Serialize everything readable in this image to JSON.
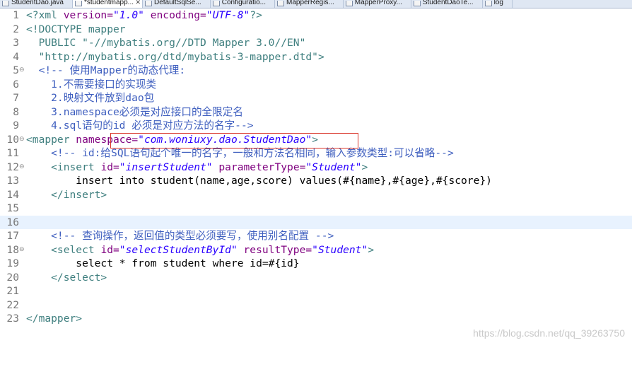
{
  "tabs": [
    {
      "label": "StudentDao.java",
      "active": false,
      "icon": "java-file-icon"
    },
    {
      "label": "*studentmapp...",
      "active": true,
      "icon": "xml-file-icon"
    },
    {
      "label": "DefaultSqlSe...",
      "active": false,
      "icon": "class-file-icon"
    },
    {
      "label": "Configuratio...",
      "active": false,
      "icon": "class-file-icon"
    },
    {
      "label": "MapperRegis...",
      "active": false,
      "icon": "class-file-icon"
    },
    {
      "label": "MapperProxy...",
      "active": false,
      "icon": "class-file-icon"
    },
    {
      "label": "StudentDaoTe...",
      "active": false,
      "icon": "java-file-icon"
    },
    {
      "label": "log",
      "active": false,
      "icon": "file-icon"
    }
  ],
  "tab_close": "✕",
  "code": {
    "l1": {
      "num": "1",
      "a": "<?xml ",
      "b": "version=",
      "c": "\"1.0\"",
      "d": " encoding=",
      "e": "\"UTF-8\"",
      "f": "?>"
    },
    "l2": {
      "num": "2",
      "a": "<!DOCTYPE mapper"
    },
    "l3": {
      "num": "3",
      "a": "  PUBLIC \"-//mybatis.org//DTD Mapper 3.0//EN\""
    },
    "l4": {
      "num": "4",
      "a": "  \"http://mybatis.org/dtd/mybatis-3-mapper.dtd\">"
    },
    "l5": {
      "num": "5",
      "a": "  <!-- 使用Mapper的动态代理:"
    },
    "l6": {
      "num": "6",
      "a": "    1.不需要接口的实现类"
    },
    "l7": {
      "num": "7",
      "a": "    2.映射文件放到dao包"
    },
    "l8": {
      "num": "8",
      "a": "    3.namespace必须是对应接口的全限定名"
    },
    "l9": {
      "num": "9",
      "a": "    4.sql语句的id 必须是对应方法的名字-->"
    },
    "l10": {
      "num": "10",
      "a": "<mapper ",
      "b": "namespace=",
      "c": "\"com.woniuxy.dao.StudentDao\"",
      "d": ">"
    },
    "l11": {
      "num": "11",
      "a": "    <!-- id:给SQL语句起个唯一的名字，一般和方法名相同，输入参数类型:可以省略-->"
    },
    "l12": {
      "num": "12",
      "a": "    <insert ",
      "b": "id=",
      "c": "\"insertStudent\"",
      "d": " parameterType=",
      "e": "\"Student\"",
      "f": ">"
    },
    "l13": {
      "num": "13",
      "a": "        insert into student(name,age,score) values(#{name},#{age},#{score})"
    },
    "l14": {
      "num": "14",
      "a": "    </insert>"
    },
    "l15": {
      "num": "15"
    },
    "l16": {
      "num": "16"
    },
    "l17": {
      "num": "17",
      "a": "    <!-- 查询操作，返回值的类型必须要写，使用别名配置 -->"
    },
    "l18": {
      "num": "18",
      "a": "    <select ",
      "b": "id=",
      "c": "\"selectStudentById\"",
      "d": " resultType=",
      "e": "\"Student\"",
      "f": ">"
    },
    "l19": {
      "num": "19",
      "a": "        select * from student where id=#{id}"
    },
    "l20": {
      "num": "20",
      "a": "    </select>"
    },
    "l21": {
      "num": "21"
    },
    "l22": {
      "num": "22"
    },
    "l23": {
      "num": "23",
      "a": "</mapper>"
    }
  },
  "fold_marker": "⊖",
  "watermark": "https://blog.csdn.net/qq_39263750",
  "colors": {
    "tag": "#3f7f7f",
    "attr": "#7f007f",
    "value": "#2a00ff",
    "comment": "#3f5fbf",
    "current_line": "#e8f2fe",
    "highlight_box": "#d9362b"
  }
}
